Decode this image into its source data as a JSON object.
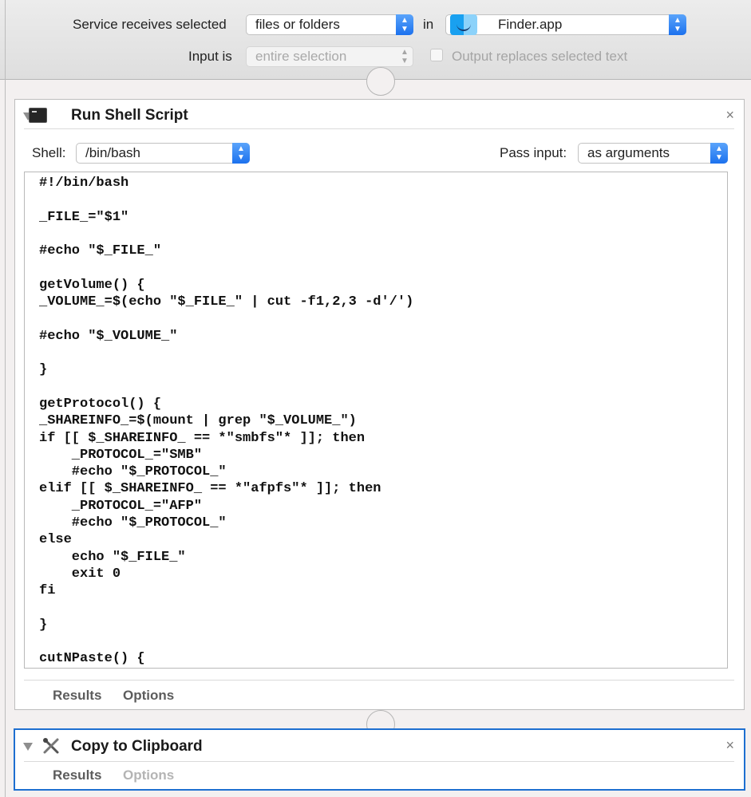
{
  "service": {
    "receives_label": "Service receives selected",
    "receives_value": "files or folders",
    "in_label": "in",
    "app_value": "Finder.app",
    "input_label": "Input is",
    "input_value": "entire selection",
    "output_label": "Output replaces selected text",
    "output_checked": false
  },
  "actions": [
    {
      "title": "Run Shell Script",
      "icon": "terminal-icon",
      "shell_label": "Shell:",
      "shell_value": "/bin/bash",
      "pass_input_label": "Pass input:",
      "pass_input_value": "as arguments",
      "script": [
        "#!/bin/bash",
        "",
        "_FILE_=\"$1\"",
        "",
        "#echo \"$_FILE_\"",
        "",
        "getVolume() {",
        "_VOLUME_=$(echo \"$_FILE_\" | cut -f1,2,3 -d'/')",
        "",
        "#echo \"$_VOLUME_\"",
        "",
        "}",
        "",
        "getProtocol() {",
        "_SHAREINFO_=$(mount | grep \"$_VOLUME_\")",
        "if [[ $_SHAREINFO_ == *\"smbfs\"* ]]; then",
        "    _PROTOCOL_=\"SMB\"",
        "    #echo \"$_PROTOCOL_\"",
        "elif [[ $_SHAREINFO_ == *\"afpfs\"* ]]; then",
        "    _PROTOCOL_=\"AFP\"",
        "    #echo \"$_PROTOCOL_\"",
        "else",
        "    echo \"$_FILE_\"",
        "    exit 0",
        "fi",
        "",
        "}",
        "",
        "cutNPaste() {"
      ],
      "tab_results": "Results",
      "tab_options": "Options",
      "close_glyph": "×"
    },
    {
      "title": "Copy to Clipboard",
      "icon": "tools-icon",
      "tab_results": "Results",
      "tab_options": "Options",
      "close_glyph": "×"
    }
  ],
  "colors": {
    "accent": "#1e6fd0",
    "stepper_blue": "#2f80f0"
  }
}
